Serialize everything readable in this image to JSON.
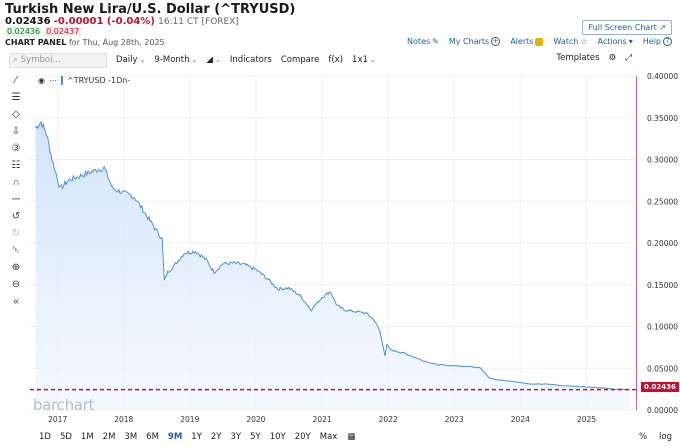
{
  "header": {
    "title": "Turkish New Lira/U.S. Dollar (^TRYUSD)",
    "last": "0.02436",
    "change": "-0.00001 (-0.04%)",
    "timestamp": "16:11 CT [FOREX]",
    "bid": "0.02436",
    "ask": "0.02437",
    "panel_label": "CHART PANEL",
    "panel_date": "for Thu, Aug 28th, 2025",
    "fullscreen_label": "Full Screen Chart"
  },
  "toplinks": {
    "notes": "Notes",
    "mycharts": "My Charts",
    "alerts": "Alerts",
    "watch": "Watch",
    "actions": "Actions",
    "help": "Help"
  },
  "toolbar": {
    "symbol_placeholder": "Symbol...",
    "interval": "Daily",
    "range": "9-Month",
    "indicators": "Indicators",
    "compare": "Compare",
    "fx": "f(x)",
    "layout": "1x1",
    "templates": "Templates"
  },
  "chart_legend": "^TRYUSD -1Dn-",
  "watermark": "barchart",
  "last_price_badge": "0.02436",
  "ranges": [
    "1D",
    "5D",
    "1M",
    "2M",
    "3M",
    "6M",
    "9M",
    "1Y",
    "2Y",
    "3Y",
    "5Y",
    "10Y",
    "20Y",
    "Max"
  ],
  "active_range": "9M",
  "bottom_right": {
    "percent": "%",
    "log": "log"
  },
  "colors": {
    "line": "#4a90e2",
    "last_line": "#c8102e",
    "accent": "#1f5fa8",
    "border": "#c060a0"
  },
  "chart_data": {
    "type": "area",
    "title": "",
    "xlabel": "",
    "ylabel": "",
    "ylim": [
      0,
      0.4
    ],
    "yticks": [
      "0.00000",
      "0.05000",
      "0.10000",
      "0.15000",
      "0.20000",
      "0.25000",
      "0.30000",
      "0.35000",
      "0.40000"
    ],
    "xticks": [
      "2017",
      "2018",
      "2019",
      "2020",
      "2021",
      "2022",
      "2023",
      "2024",
      "2025"
    ],
    "last_value": 0.02436,
    "series": [
      {
        "name": "^TRYUSD",
        "x": [
          "2016-09-01",
          "2016-10-01",
          "2016-11-01",
          "2016-12-01",
          "2017-01-15",
          "2017-03-01",
          "2017-05-01",
          "2017-07-01",
          "2017-09-15",
          "2017-11-01",
          "2018-01-01",
          "2018-03-01",
          "2018-05-01",
          "2018-06-15",
          "2018-08-01",
          "2018-08-13",
          "2018-09-01",
          "2018-10-15",
          "2018-12-01",
          "2019-02-01",
          "2019-04-01",
          "2019-05-15",
          "2019-07-01",
          "2019-09-01",
          "2019-11-01",
          "2020-01-01",
          "2020-03-01",
          "2020-05-01",
          "2020-07-01",
          "2020-09-01",
          "2020-11-01",
          "2021-01-01",
          "2021-02-15",
          "2021-03-25",
          "2021-05-01",
          "2021-07-01",
          "2021-09-01",
          "2021-10-15",
          "2021-11-15",
          "2021-12-15",
          "2021-12-25",
          "2022-01-15",
          "2022-04-01",
          "2022-07-01",
          "2022-10-01",
          "2023-01-01",
          "2023-04-01",
          "2023-05-25",
          "2023-06-15",
          "2023-07-15",
          "2023-09-01",
          "2023-12-01",
          "2024-03-01",
          "2024-06-01",
          "2024-09-01",
          "2024-12-01",
          "2025-03-01",
          "2025-06-01",
          "2025-08-28"
        ],
        "values": [
          0.338,
          0.345,
          0.33,
          0.3,
          0.265,
          0.275,
          0.28,
          0.285,
          0.29,
          0.265,
          0.26,
          0.255,
          0.235,
          0.22,
          0.205,
          0.155,
          0.165,
          0.175,
          0.188,
          0.19,
          0.18,
          0.165,
          0.175,
          0.176,
          0.174,
          0.168,
          0.158,
          0.145,
          0.146,
          0.137,
          0.12,
          0.135,
          0.142,
          0.125,
          0.12,
          0.118,
          0.116,
          0.108,
          0.095,
          0.065,
          0.078,
          0.072,
          0.068,
          0.06,
          0.054,
          0.053,
          0.052,
          0.051,
          0.045,
          0.038,
          0.036,
          0.034,
          0.031,
          0.031,
          0.029,
          0.028,
          0.027,
          0.025,
          0.0244
        ]
      }
    ]
  }
}
